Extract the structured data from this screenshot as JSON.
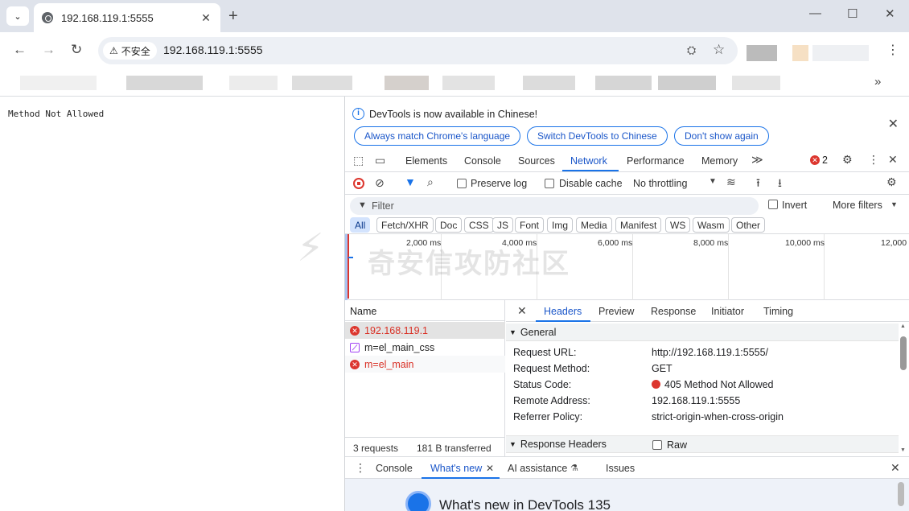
{
  "browser": {
    "tab_title": "192.168.119.1:5555",
    "omnibox": {
      "security_label": "不安全",
      "url": "192.168.119.1:5555"
    },
    "bookmarks_more": "»"
  },
  "page": {
    "body_text": "Method Not Allowed"
  },
  "devtools": {
    "infobar": {
      "message": "DevTools is now available in Chinese!",
      "buttons": [
        "Always match Chrome's language",
        "Switch DevTools to Chinese",
        "Don't show again"
      ]
    },
    "main_tabs": [
      "Elements",
      "Console",
      "Sources",
      "Network",
      "Performance",
      "Memory"
    ],
    "active_tab": "Network",
    "error_count": "2",
    "network_toolbar": {
      "preserve_log": "Preserve log",
      "disable_cache": "Disable cache",
      "throttling": "No throttling"
    },
    "filter": {
      "placeholder": "Filter",
      "invert": "Invert",
      "more_filters": "More filters"
    },
    "type_filters": [
      "All",
      "Fetch/XHR",
      "Doc",
      "CSS",
      "JS",
      "Font",
      "Img",
      "Media",
      "Manifest",
      "WS",
      "Wasm",
      "Other"
    ],
    "timeline_ticks": [
      "2,000 ms",
      "4,000 ms",
      "6,000 ms",
      "8,000 ms",
      "10,000 ms",
      "12,000"
    ],
    "name_header": "Name",
    "requests": [
      {
        "name": "192.168.119.1",
        "status": "error"
      },
      {
        "name": "m=el_main_css",
        "status": "css"
      },
      {
        "name": "m=el_main",
        "status": "error"
      }
    ],
    "status_bar": {
      "requests": "3 requests",
      "transferred": "181 B transferred"
    },
    "detail_tabs": [
      "Headers",
      "Preview",
      "Response",
      "Initiator",
      "Timing"
    ],
    "active_detail_tab": "Headers",
    "general": {
      "title": "General",
      "rows": [
        {
          "key": "Request URL:",
          "value": "http://192.168.119.1:5555/"
        },
        {
          "key": "Request Method:",
          "value": "GET"
        },
        {
          "key": "Status Code:",
          "value": "405 Method Not Allowed"
        },
        {
          "key": "Remote Address:",
          "value": "192.168.119.1:5555"
        },
        {
          "key": "Referrer Policy:",
          "value": "strict-origin-when-cross-origin"
        }
      ]
    },
    "response_headers": {
      "title": "Response Headers",
      "raw": "Raw"
    },
    "drawer_tabs": [
      "Console",
      "What's new",
      "AI assistance",
      "Issues"
    ],
    "drawer_active": "What's new",
    "drawer_title": "What's new in DevTools 135"
  },
  "watermark": "奇安信攻防社区",
  "colors": {
    "accent": "#1a73e8",
    "error": "#dc362e",
    "tabstrip": "#dfe3eb"
  }
}
